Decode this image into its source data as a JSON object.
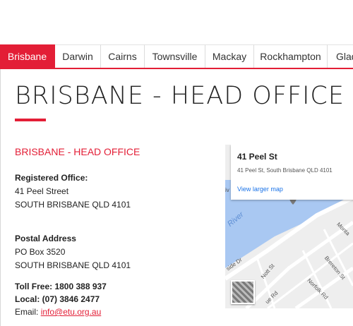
{
  "tabs": [
    {
      "label": "Brisbane",
      "active": true
    },
    {
      "label": "Darwin",
      "active": false
    },
    {
      "label": "Cairns",
      "active": false
    },
    {
      "label": "Townsville",
      "active": false
    },
    {
      "label": "Mackay",
      "active": false
    },
    {
      "label": "Rockhampton",
      "active": false
    },
    {
      "label": "Glad",
      "active": false
    }
  ],
  "office": {
    "title": "BRISBANE - HEAD OFFICE",
    "subtitle": "BRISBANE - HEAD OFFICE",
    "registered_label": "Registered Office:",
    "registered_street": "41 Peel Street",
    "registered_city": "SOUTH BRISBANE QLD 4101",
    "postal_label": "Postal Address",
    "postal_box": "PO Box 3520",
    "postal_city": "SOUTH BRISBANE QLD 4101",
    "tollfree": "Toll Free: 1800 388 937",
    "local": "Local: (07) 3846 2477",
    "email_label": "Email: ",
    "email": "info@etu.org.au"
  },
  "map": {
    "place_title": "41 Peel St",
    "place_address": "41 Peel St, South Brisbane QLD 4101",
    "larger_map": "View larger map",
    "river_label": "River",
    "labels": [
      "Nott St",
      "Brereton St",
      "Norfolk Rd",
      "ue Rd",
      "Monta",
      "side Dr",
      "iv"
    ]
  },
  "colors": {
    "accent": "#e31e36",
    "link": "#1a73e8",
    "water": "#a9c8f2"
  }
}
